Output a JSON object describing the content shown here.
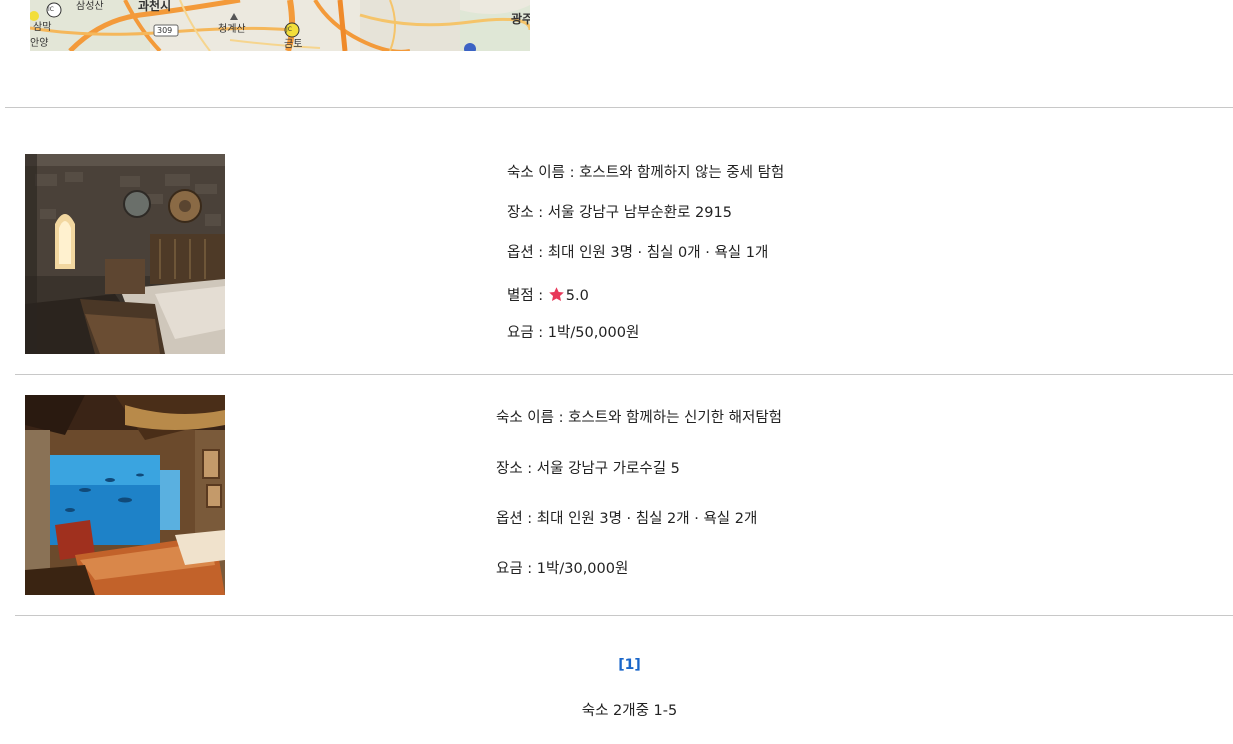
{
  "map": {
    "labels": [
      "삼성산",
      "과천시",
      "청계산",
      "광주",
      "삼막",
      "안양",
      "금토"
    ],
    "route_badge": "309",
    "jc_badges": [
      "IC",
      "JC"
    ]
  },
  "listings": [
    {
      "name_label": "숙소 이름 : ",
      "name": "호스트와 함께하지 않는 중세 탐험",
      "place_label": "장소 : ",
      "place": "서울 강남구 남부순환로 2915",
      "options_label": "옵션 : ",
      "options": "최대 인원 3명 · 침실 0개 · 욕실 1개",
      "rating_label": "별점 : ",
      "rating": "5.0",
      "price_label": "요금 : ",
      "price": "1박/50,000원"
    },
    {
      "name_label": "숙소 이름 : ",
      "name": "호스트와 함께하는 신기한 해저탐험",
      "place_label": "장소 : ",
      "place": "서울 강남구 가로수길 5",
      "options_label": "옵션 : ",
      "options": "최대 인원 3명 · 침실 2개 · 욕실 2개",
      "price_label": "요금 : ",
      "price": "1박/30,000원"
    }
  ],
  "pagination": {
    "current": "[1]"
  },
  "summary": "숙소 2개중 1-5",
  "colors": {
    "link": "#1a66c9",
    "star": "#e8395a",
    "rule": "#c8c8c8"
  }
}
